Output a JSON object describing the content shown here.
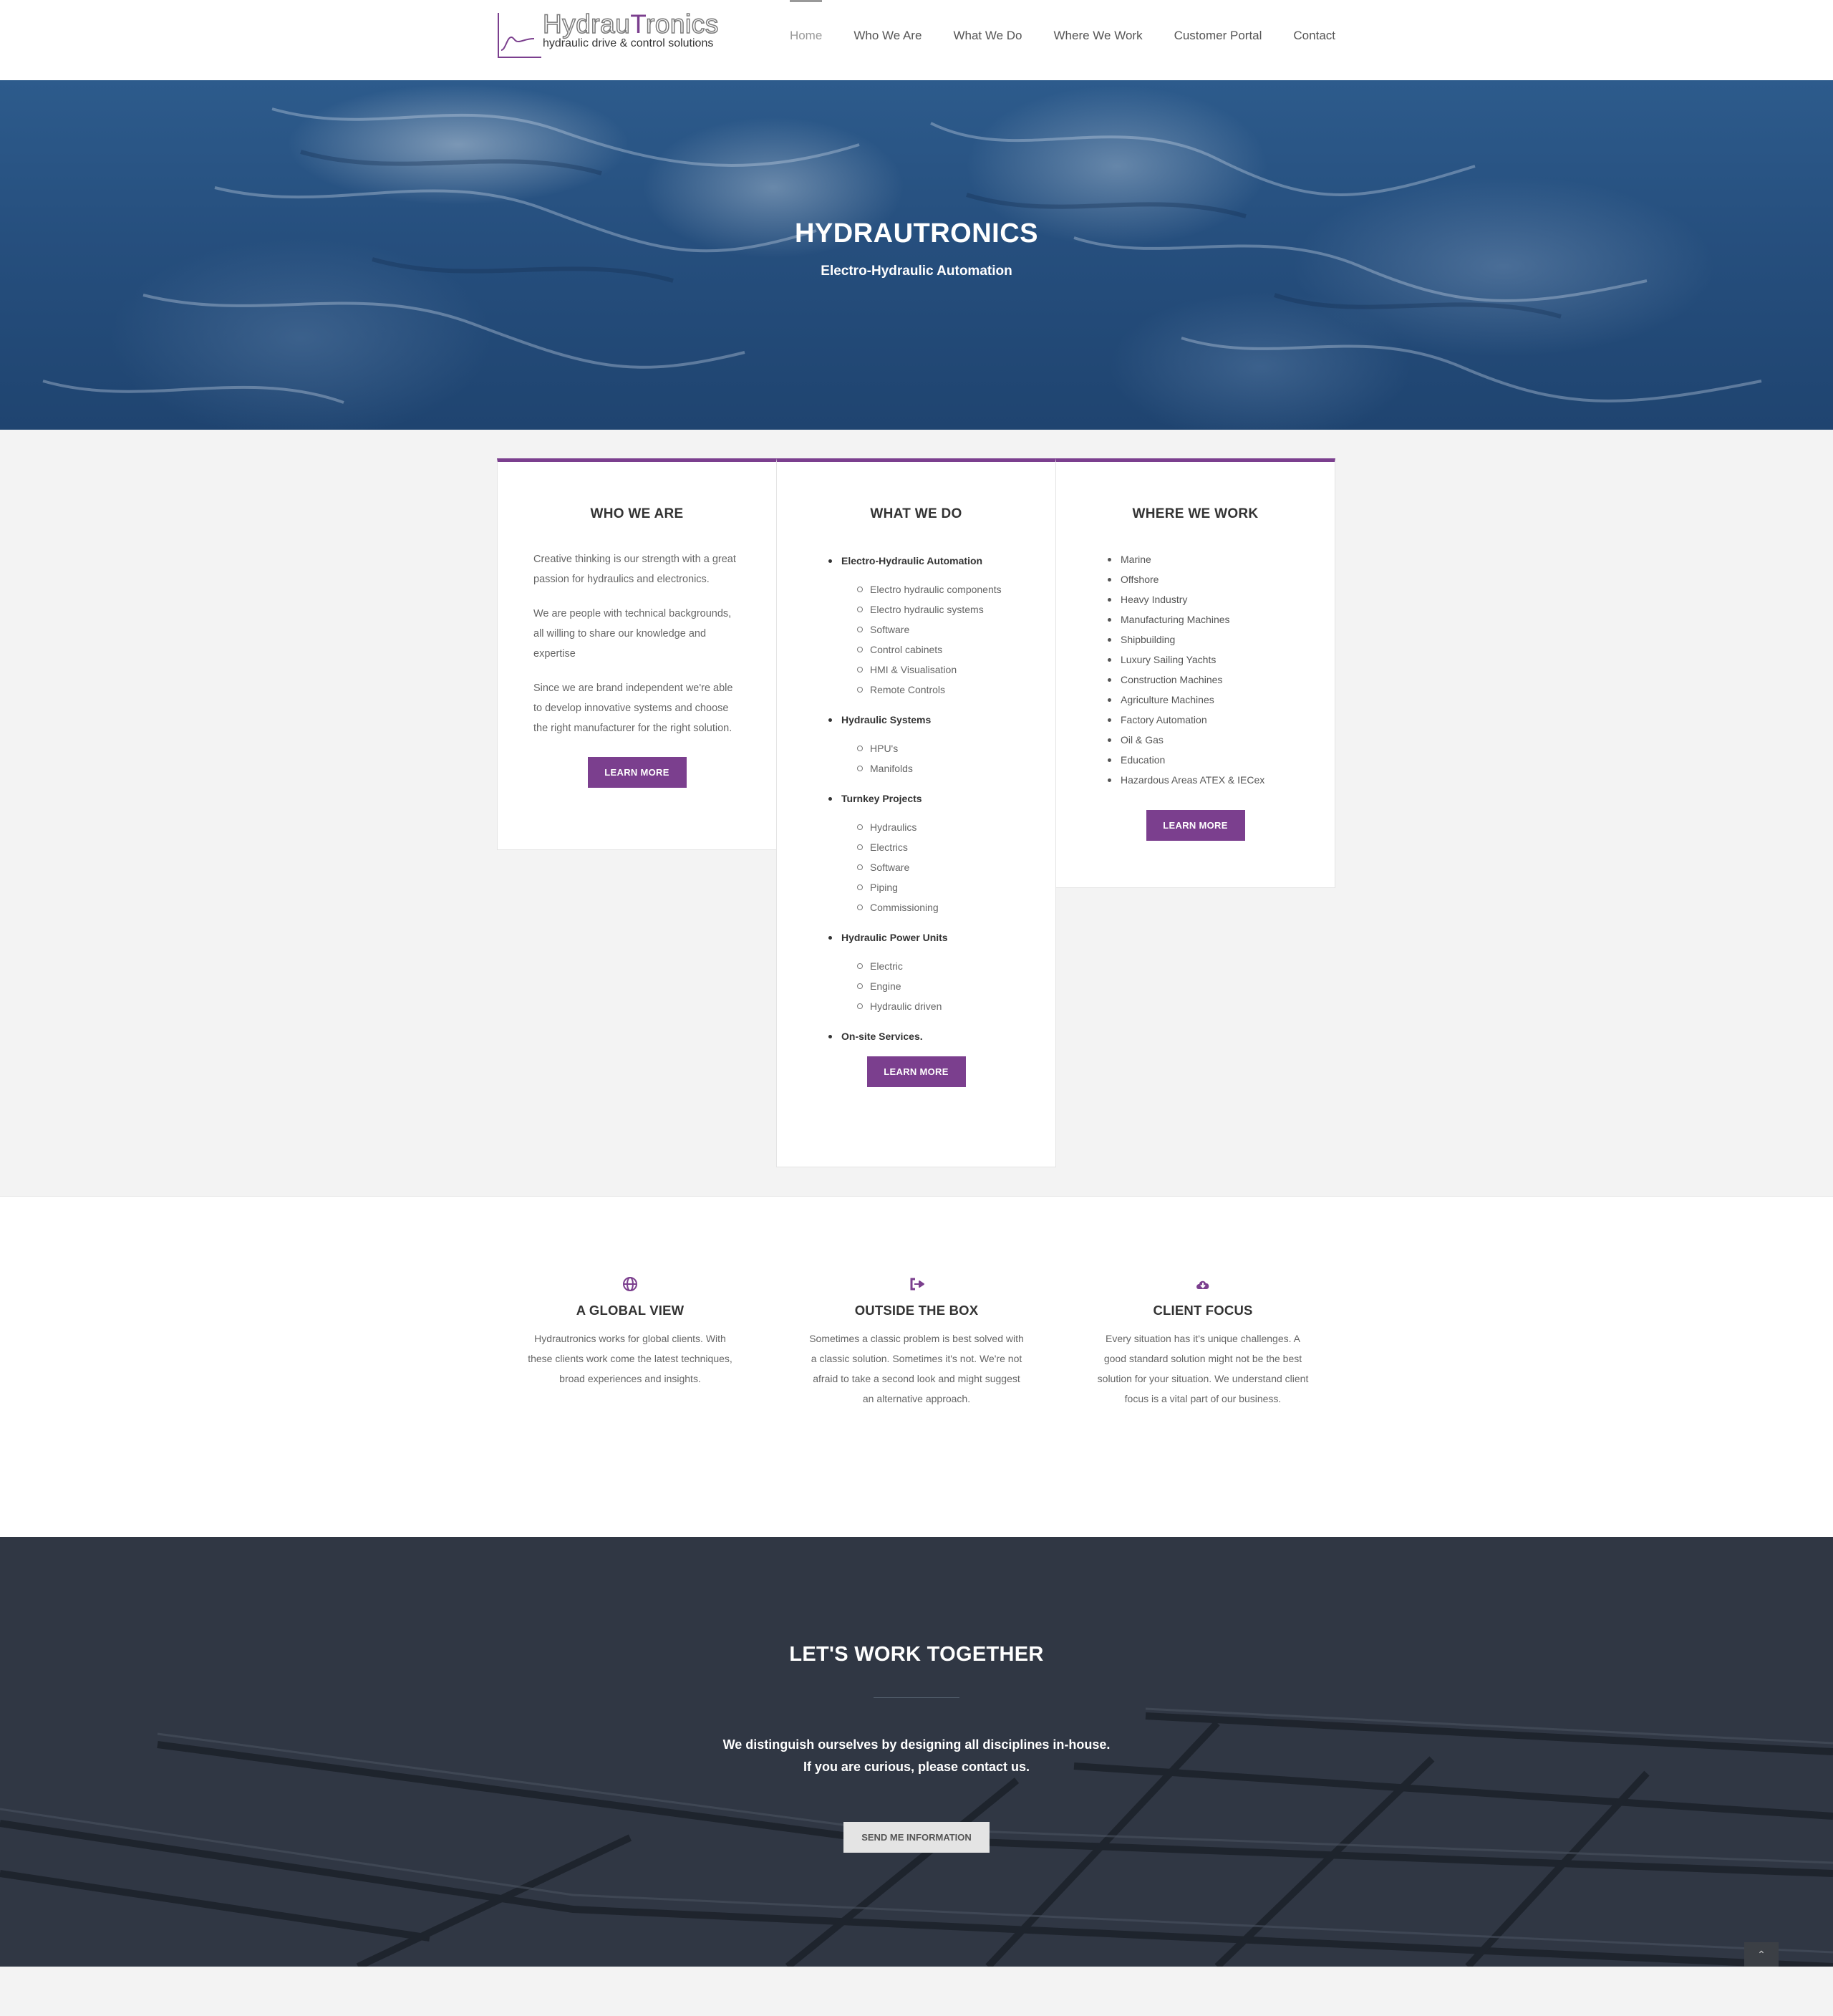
{
  "header": {
    "logo": {
      "name_prefix": "Hydrau",
      "name_mid": "T",
      "name_suffix": "ronics",
      "tagline": "hydraulic drive & control solutions"
    },
    "nav": [
      "Home",
      "Who We Are",
      "What We Do",
      "Where We Work",
      "Customer Portal",
      "Contact"
    ],
    "active_nav": "Home"
  },
  "hero": {
    "title": "HYDRAUTRONICS",
    "subtitle": "Electro-Hydraulic Automation"
  },
  "cards": {
    "who": {
      "title": "WHO WE ARE",
      "paragraphs": [
        "Creative thinking is our strength with a great passion for hydraulics and electronics.",
        "We are people with technical backgrounds, all willing to share our knowledge and expertise",
        "Since we are brand independent we're able to develop innovative systems and choose the right manufacturer for the right solution."
      ],
      "button": "LEARN MORE"
    },
    "what": {
      "title": "WHAT WE DO",
      "groups": [
        {
          "label": "Electro-Hydraulic Automation",
          "items": [
            "Electro hydraulic components",
            "Electro hydraulic systems",
            "Software",
            "Control cabinets",
            "HMI & Visualisation",
            "Remote Controls"
          ]
        },
        {
          "label": "Hydraulic Systems",
          "items": [
            "HPU's",
            "Manifolds"
          ]
        },
        {
          "label": "Turnkey Projects",
          "items": [
            "Hydraulics",
            "Electrics",
            "Software",
            "Piping",
            "Commissioning"
          ]
        },
        {
          "label": "Hydraulic Power Units",
          "items": [
            "Electric",
            "Engine",
            "Hydraulic driven"
          ]
        },
        {
          "label": "On-site Services.",
          "items": []
        }
      ],
      "button": "LEARN MORE"
    },
    "where": {
      "title": "WHERE WE WORK",
      "items": [
        "Marine",
        "Offshore",
        "Heavy Industry",
        "Manufacturing Machines",
        "Shipbuilding",
        "Luxury Sailing Yachts",
        "Construction Machines",
        "Agriculture Machines",
        "Factory Automation",
        "Oil & Gas",
        "Education",
        "Hazardous Areas ATEX & IECex"
      ],
      "button": "LEARN MORE"
    }
  },
  "features": [
    {
      "icon": "globe-icon",
      "title": "A GLOBAL VIEW",
      "text": "Hydrautronics works for global clients. With these clients work come the latest techniques, broad experiences and insights."
    },
    {
      "icon": "sign-out-icon",
      "title": "OUTSIDE THE BOX",
      "text": "Sometimes a classic problem is best solved with a classic solution. Sometimes it's not. We're not afraid to take a second look and might suggest an alternative approach."
    },
    {
      "icon": "cloud-download-icon",
      "title": "CLIENT FOCUS",
      "text": "Every situation has it's unique challenges. A good standard solution might not be the best solution for your situation. We understand client focus is a vital part of our business."
    }
  ],
  "cta": {
    "title": "LET'S WORK TOGETHER",
    "line1": "We distinguish ourselves by designing all disciplines in-house.",
    "line2": "If you are curious, please contact us.",
    "button": "SEND ME INFORMATION"
  },
  "colors": {
    "accent": "#7b3f8e",
    "cta_bg": "#303744",
    "hero": "#264f7e"
  }
}
